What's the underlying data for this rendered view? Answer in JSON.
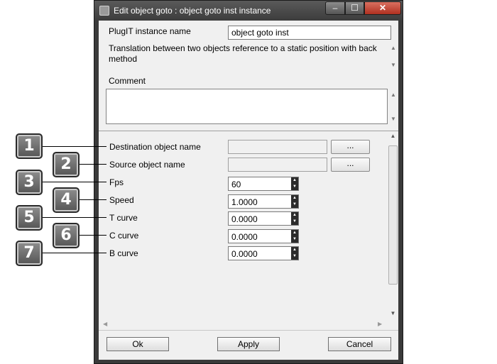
{
  "window": {
    "title": "Edit object goto : object goto inst instance"
  },
  "instance": {
    "label": "PlugIT instance name",
    "value": "object goto inst"
  },
  "description": "Translation between two objects reference to a static position with back method",
  "comment": {
    "label": "Comment",
    "value": ""
  },
  "fields": [
    {
      "label": "Destination object name",
      "value": "",
      "button": "..."
    },
    {
      "label": "Source object name",
      "value": "",
      "button": "..."
    },
    {
      "label": "Fps",
      "value": "60"
    },
    {
      "label": "Speed",
      "value": "1.0000"
    },
    {
      "label": "T curve",
      "value": "0.0000"
    },
    {
      "label": "C curve",
      "value": "0.0000"
    },
    {
      "label": "B curve",
      "value": "0.0000"
    }
  ],
  "callouts": [
    "1",
    "2",
    "3",
    "4",
    "5",
    "6",
    "7"
  ],
  "buttons": {
    "ok": "Ok",
    "apply": "Apply",
    "cancel": "Cancel"
  }
}
